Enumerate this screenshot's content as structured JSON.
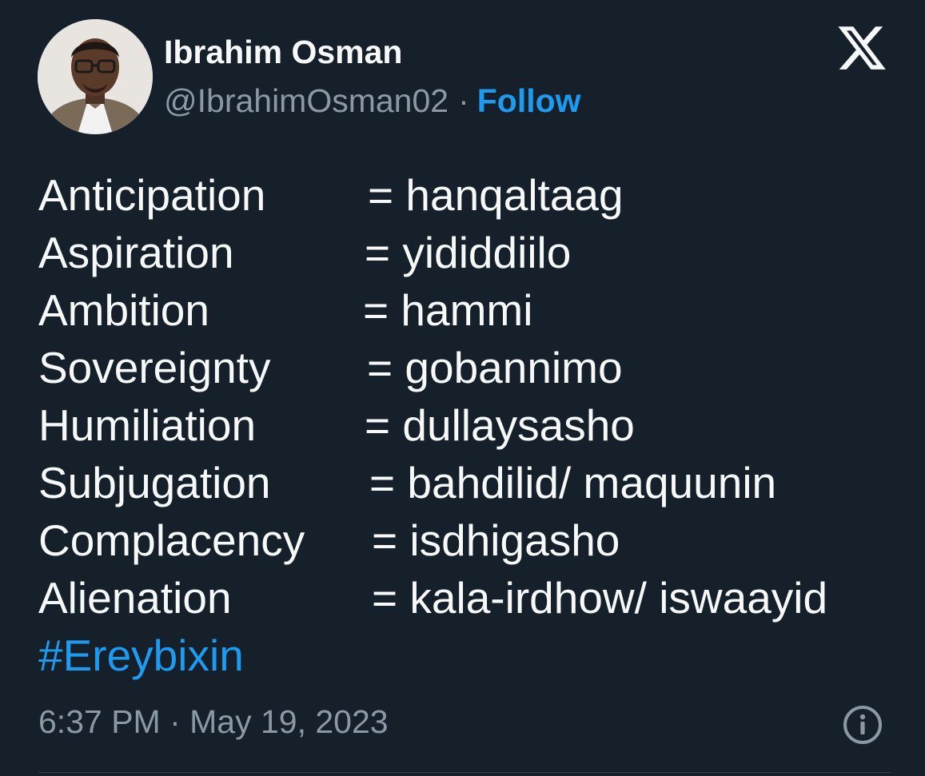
{
  "tweet": {
    "author": {
      "name": "Ibrahim Osman",
      "handle": "@IbrahimOsman02",
      "separator": "·",
      "follow_label": "Follow"
    },
    "platform_icon": "x-logo-icon",
    "glossary": [
      {
        "term": "Anticipation",
        "definition": "= hanqaltaag"
      },
      {
        "term": "Aspiration",
        "definition": "= yididdiilo"
      },
      {
        "term": "Ambition",
        "definition": "= hammi"
      },
      {
        "term": "Sovereignty",
        "definition": "= gobannimo"
      },
      {
        "term": "Humiliation",
        "definition": "= dullaysasho"
      },
      {
        "term": "Subjugation",
        "definition": "= bahdilid/ maquunin"
      },
      {
        "term": "Complacency",
        "definition": "= isdhigasho"
      },
      {
        "term": "Alienation",
        "definition": "= kala-irdhow/ iswaayid"
      }
    ],
    "hashtag": "#Ereybixin",
    "timestamp": "6:37 PM · May 19, 2023",
    "info_icon": "info-icon"
  },
  "colors": {
    "background": "#15202b",
    "text": "#f7f9f9",
    "secondary_text": "#8b98a5",
    "accent": "#1d9bf0"
  }
}
